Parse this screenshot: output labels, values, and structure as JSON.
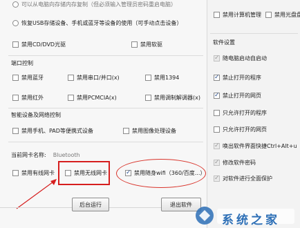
{
  "top": {
    "cut_option": "可以从电脑向存储内存复制（但必须输入管理员密码重启电脑）",
    "restore_usb": "恢复USB存储设备、手机或蓝牙等设备的使用（可手动点击设备）"
  },
  "left": {
    "cd_label": "禁用CD/DVD光驱",
    "floppy_label": "禁用软驱",
    "port_section": "端口控制",
    "bluetooth": "禁用蓝牙",
    "serial": "禁用串口/并口(x)",
    "ieee1394": "禁用1394",
    "infrared": "禁用红外",
    "pcmcia": "禁用PCMCIA(x)",
    "modem": "禁用调制解调器(x)",
    "smart_section": "智能设备及网络控制",
    "phone": "禁用手机、PAD等便携式设备",
    "imaging": "禁用图像处理设备",
    "nic_label": "当前网卡名称:",
    "nic_value": "Bluetooth",
    "wired": "禁用有线网卡",
    "wireless": "禁用无线网卡",
    "portable_wifi": "禁用随身wifi（360/百度...）",
    "run_background": "后台运行",
    "exit_software": "退出软件"
  },
  "right": {
    "disable_computer_mgmt": "禁用计算机管理",
    "disable_cd_letter": "禁用光盘盘符",
    "software_section": "软件设置",
    "items": [
      {
        "label": "随电脑启动自启动",
        "checked": true,
        "disabled": true
      },
      {
        "label": "禁止打开的程序",
        "checked": true,
        "disabled": false
      },
      {
        "label": "禁止打开的网页",
        "checked": true,
        "disabled": false
      },
      {
        "label": "只允许打开的程序",
        "checked": false,
        "disabled": false
      },
      {
        "label": "只允许打开的网页",
        "checked": false,
        "disabled": false
      },
      {
        "label": "唤出软件界面快捷Ctrl+Alt+u",
        "checked": true,
        "disabled": true
      },
      {
        "label": "修改软件密码",
        "checked": true,
        "disabled": true
      },
      {
        "label": "对软件进行全面保护",
        "checked": true,
        "disabled": true
      }
    ]
  },
  "watermark": {
    "text": "系统之家"
  },
  "colors": {
    "highlight_red": "#d61e1e",
    "check_blue": "#2a4f8f",
    "watermark_blue": "#2d6fb6"
  }
}
